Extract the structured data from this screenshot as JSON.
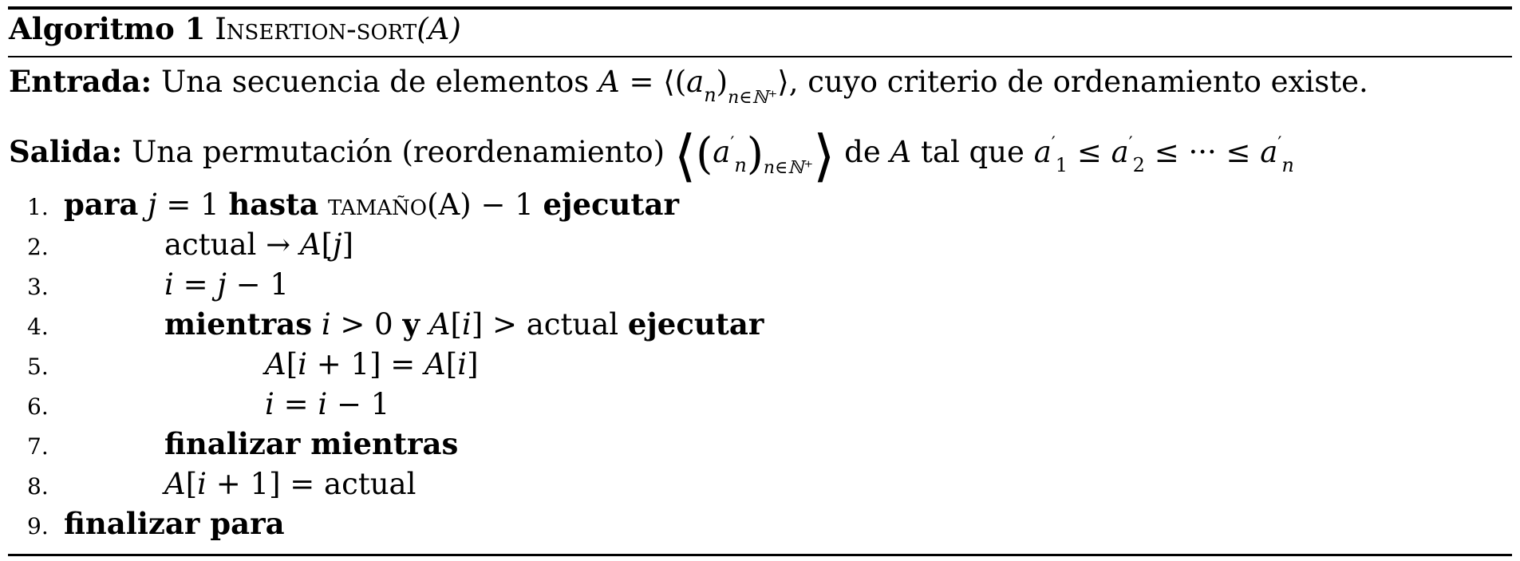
{
  "caption": {
    "label": "Algoritmo 1",
    "name": "Insertion-sort",
    "arg": "(A)"
  },
  "entrada": {
    "label": "Entrada:",
    "text_before": "Una secuencia de elementos",
    "seq_var": "A",
    "seq_eq": " = ⟨(",
    "seq_elem": "a",
    "seq_elem_sub": "n",
    "seq_close": ")",
    "seq_index": "n∈ℕ⁺",
    "seq_end": "⟩",
    "text_after": ", cuyo criterio de ordenamiento existe."
  },
  "salida": {
    "label": "Salida:",
    "text_before": "Una permutación (reordenamiento)",
    "open_angle": "⟨",
    "open_paren": "(",
    "elem": "a",
    "prime": "′",
    "elem_sub": "n",
    "close_paren": ")",
    "index": "n∈ℕ⁺",
    "close_angle": "⟩",
    "de": "de",
    "var_a": "A",
    "tal_que": "tal que",
    "a1": "a",
    "a1_sub": "1",
    "le1": "≤",
    "a2": "a",
    "a2_sub": "2",
    "le2": "≤ ··· ≤",
    "an": "a",
    "an_sub": "n"
  },
  "lines": [
    {
      "num": "1.",
      "kw1": "para",
      "m1": "j",
      "t1": " = 1 ",
      "kw2": "hasta",
      "t2": " tamaño",
      "t3": "(A) − 1 ",
      "kw3": "ejecutar"
    },
    {
      "num": "2.",
      "t1": "actual → ",
      "m1": "A",
      "t2": "[",
      "m2": "j",
      "t3": "]"
    },
    {
      "num": "3.",
      "m1": "i",
      "t1": " = ",
      "m2": "j",
      "t2": " − 1"
    },
    {
      "num": "4.",
      "kw1": "mientras",
      "m1": "i",
      "t1": " > 0 ",
      "kw2": "y",
      "m2": "A",
      "t2": "[",
      "m3": "i",
      "t3": "] > actual  ",
      "kw3": "ejecutar"
    },
    {
      "num": "5.",
      "m1": "A",
      "t1": "[",
      "m2": "i",
      "t2": " + 1] = ",
      "m3": "A",
      "t3": "[",
      "m4": "i",
      "t4": "]"
    },
    {
      "num": "6.",
      "m1": "i",
      "t1": " = ",
      "m2": "i",
      "t2": " − 1"
    },
    {
      "num": "7.",
      "kw1": "finalizar mientras"
    },
    {
      "num": "8.",
      "m1": "A",
      "t1": "[",
      "m2": "i",
      "t2": " + 1] = actual"
    },
    {
      "num": "9.",
      "kw1": "finalizar para"
    }
  ]
}
